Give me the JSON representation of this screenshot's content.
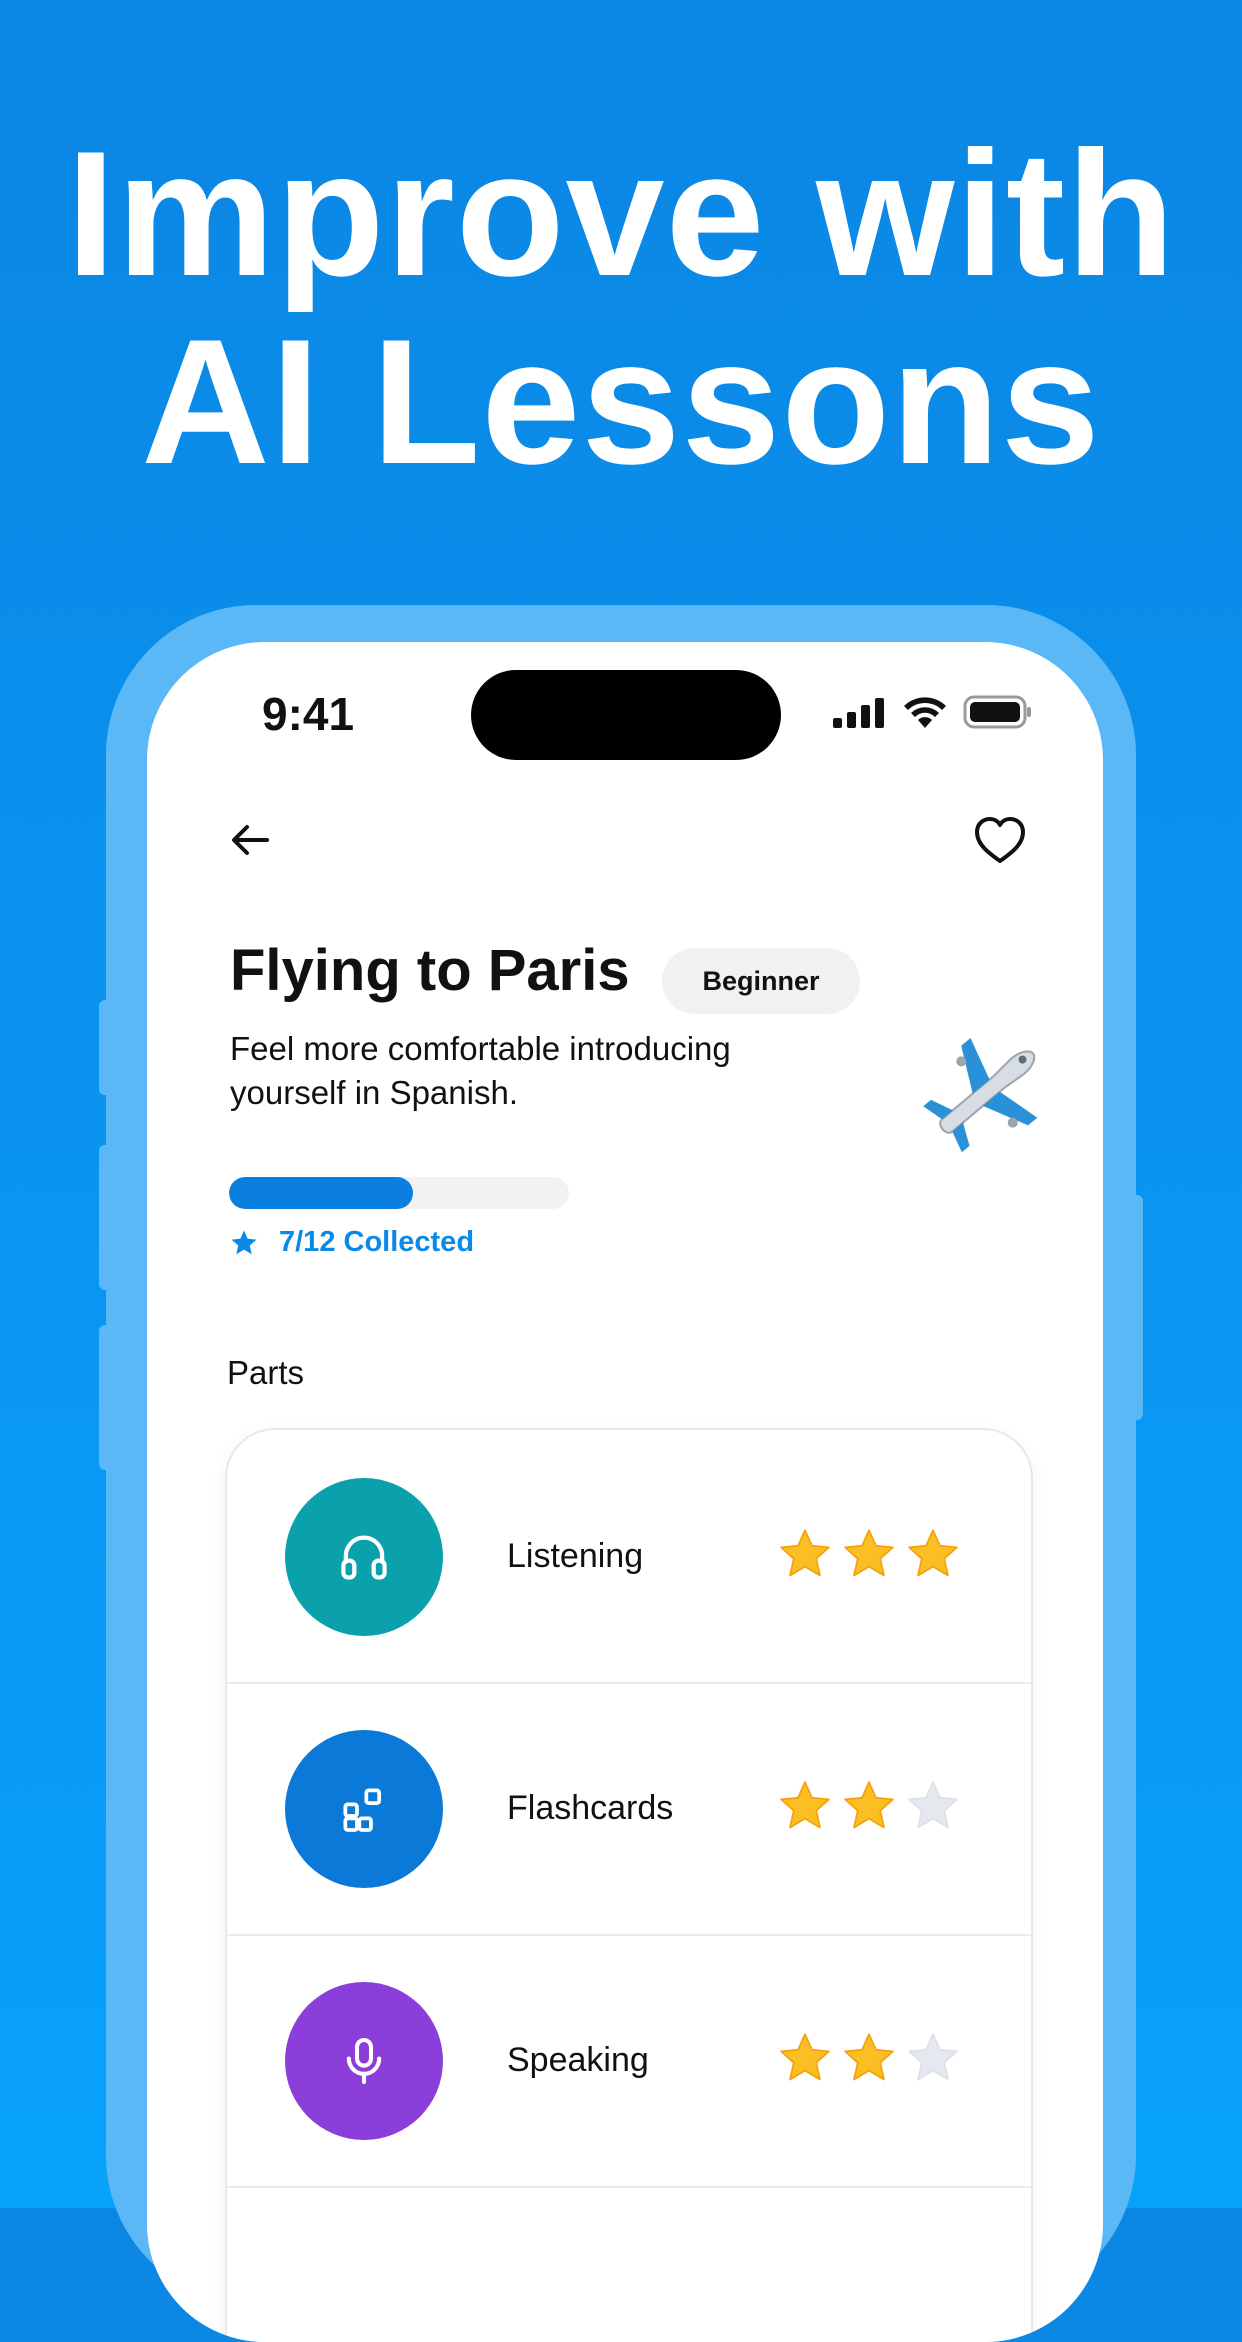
{
  "headline": {
    "line1": "Improve with",
    "line2": "AI Lessons"
  },
  "status_bar": {
    "time": "9:41"
  },
  "lesson": {
    "title": "Flying to Paris",
    "level": "Beginner",
    "description": "Feel more comfortable introducing yourself in Spanish.",
    "emoji": "airplane",
    "progress": 0.5,
    "collected_text": "7/12 Collected"
  },
  "parts": {
    "section_label": "Parts",
    "items": [
      {
        "label": "Listening",
        "icon": "headphones-icon",
        "color": "#0aa1ad",
        "stars": 3
      },
      {
        "label": "Flashcards",
        "icon": "flashcards-icon",
        "color": "#0b79d8",
        "stars": 2
      },
      {
        "label": "Speaking",
        "icon": "microphone-icon",
        "color": "#8b3ed9",
        "stars": 2
      }
    ]
  },
  "colors": {
    "accent": "#0a7fe0",
    "star_filled": "#fbbf24",
    "star_empty": "#e5e9ef"
  }
}
